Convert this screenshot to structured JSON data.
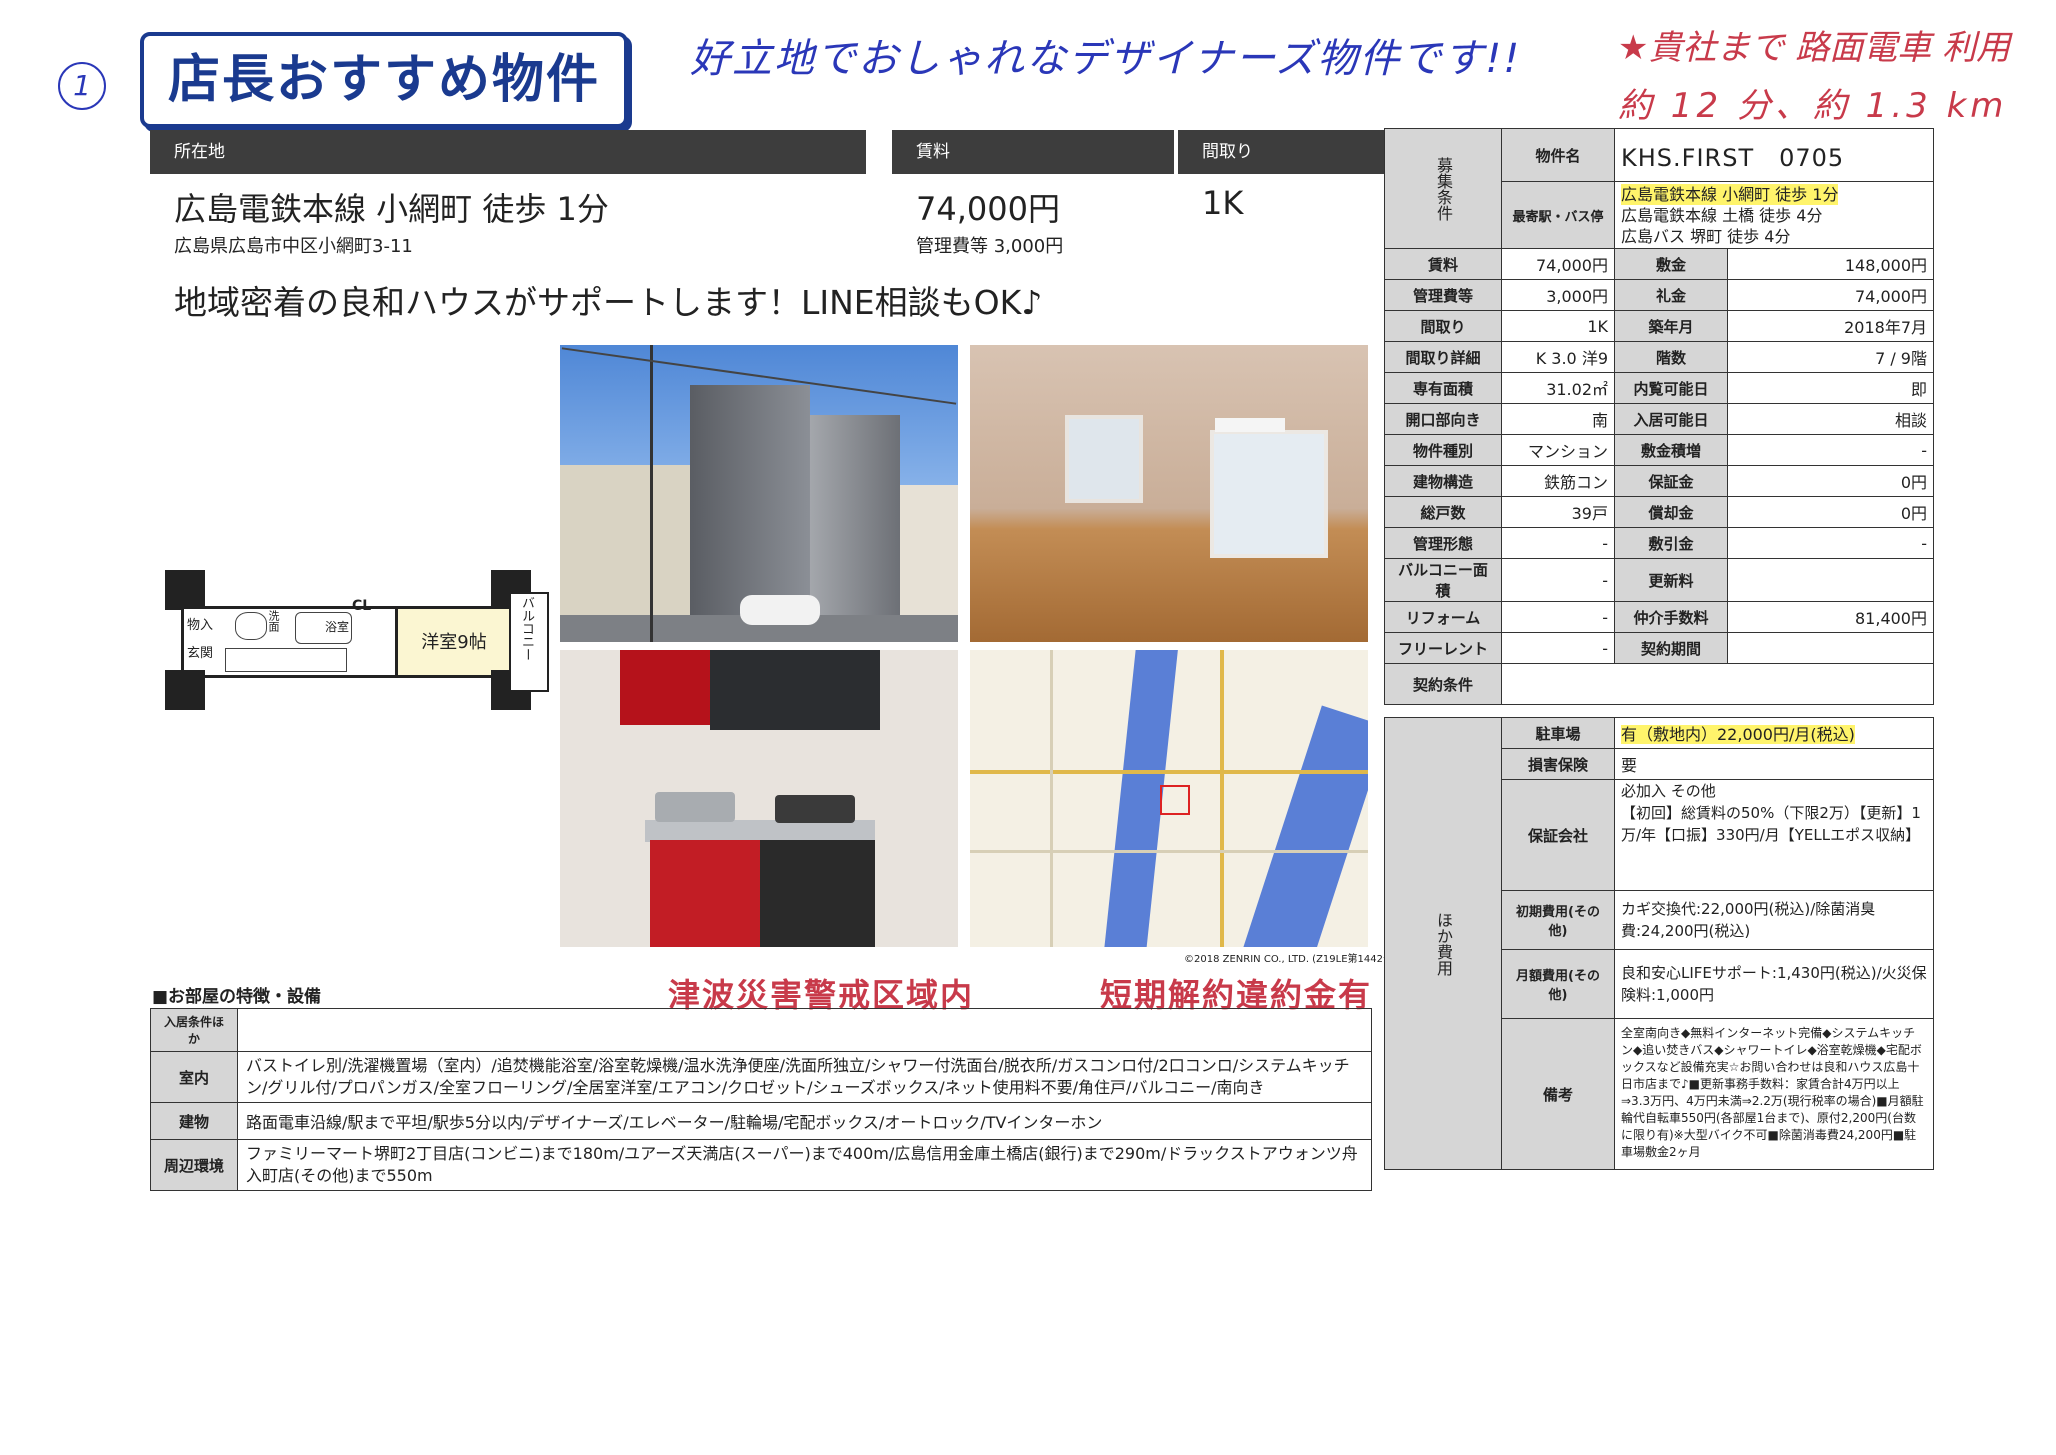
{
  "handwriting": {
    "number": "1",
    "comment": "好立地でおしゃれなデザイナーズ物件です!!",
    "access_line1": "★貴社まで 路面電車 利用",
    "access_line2": "約 12 分、約 1.3 km"
  },
  "badge": "店長おすすめ物件",
  "header": {
    "location_label": "所在地",
    "rent_label": "賃料",
    "layout_label": "間取り",
    "station_access": "広島電鉄本線 小網町 徒歩 1分",
    "address": "広島県広島市中区小網町3-11",
    "rent": "74,000円",
    "mgmt_fee": "管理費等 3,000円",
    "layout": "1K"
  },
  "catchcopy": "地域密着の良和ハウスがサポートします！LINE相談もOK♪",
  "floorplan": {
    "room": "洋室9帖",
    "balcony": "バルコニー",
    "closet": "CL",
    "storage": "物入",
    "entrance": "玄関",
    "washroom": "洗面",
    "bath": "浴室"
  },
  "map_credit": "©2018 ZENRIN CO., LTD. (Z19LE第1442号)",
  "stamps": {
    "tsunami": "津波災害警戒区域内",
    "penalty": "短期解約違約金有"
  },
  "features": {
    "title": "■お部屋の特徴・設備",
    "rows": [
      {
        "label": "入居条件ほか",
        "value": ""
      },
      {
        "label": "室内",
        "value": "バストイレ別/洗濯機置場（室内）/追焚機能浴室/浴室乾燥機/温水洗浄便座/洗面所独立/シャワー付洗面台/脱衣所/ガスコンロ付/2口コンロ/システムキッチン/グリル付/プロパンガス/全室フローリング/全居室洋室/エアコン/クロゼット/シューズボックス/ネット使用料不要/角住戸/バルコニー/南向き"
      },
      {
        "label": "建物",
        "value": "路面電車沿線/駅まで平坦/駅歩5分以内/デザイナーズ/エレベーター/駐輪場/宅配ボックス/オートロック/TVインターホン"
      },
      {
        "label": "周辺環境",
        "value": "ファミリーマート堺町2丁目店(コンビニ)まで180m/ユアーズ天満店(スーパー)まで400m/広島信用金庫土橋店(銀行)まで290m/ドラックストアウォンツ舟入町店(その他)まで550m"
      }
    ]
  },
  "spec": {
    "property_label": "物件名",
    "property_name": "KHS.FIRST　0705",
    "station_label": "最寄駅・バス停",
    "stations": [
      "広島電鉄本線 小網町 徒歩 1分",
      "広島電鉄本線 土橋 徒歩 4分",
      "広島バス 堺町 徒歩 4分"
    ],
    "recruit_side": "募集条件",
    "rows": [
      [
        "賃料",
        "74,000円",
        "敷金",
        "148,000円"
      ],
      [
        "管理費等",
        "3,000円",
        "礼金",
        "74,000円"
      ],
      [
        "間取り",
        "1K",
        "築年月",
        "2018年7月"
      ],
      [
        "間取り詳細",
        "K 3.0 洋9",
        "階数",
        "7 / 9階"
      ],
      [
        "専有面積",
        "31.02㎡",
        "内覧可能日",
        "即"
      ],
      [
        "開口部向き",
        "南",
        "入居可能日",
        "相談"
      ],
      [
        "物件種別",
        "マンション",
        "敷金積増",
        "-"
      ],
      [
        "建物構造",
        "鉄筋コン",
        "保証金",
        "0円"
      ],
      [
        "総戸数",
        "39戸",
        "償却金",
        "0円"
      ],
      [
        "管理形態",
        "-",
        "敷引金",
        "-"
      ],
      [
        "バルコニー面積",
        "-",
        "更新料",
        ""
      ],
      [
        "リフォーム",
        "-",
        "仲介手数料",
        "81,400円"
      ],
      [
        "フリーレント",
        "-",
        "契約期間",
        ""
      ]
    ],
    "contract_label": "契約条件",
    "other_side": "ほか費用",
    "parking_label": "駐車場",
    "parking": "有（敷地内）22,000円/月(税込)",
    "insurance_label": "損害保険",
    "insurance": "要",
    "guarantor_label": "保証会社",
    "guarantor": "必加入 その他\n【初回】総賃料の50%（下限2万）【更新】1万/年【口振】330円/月【YELLエポス収納】",
    "initial_label": "初期費用(その他)",
    "initial": "カギ交換代:22,000円(税込)/除菌消臭費:24,200円(税込)",
    "monthly_label": "月額費用(その他)",
    "monthly": "良和安心LIFEサポート:1,430円(税込)/火災保険料:1,000円",
    "notes_label": "備考",
    "notes": "全室南向き◆無料インターネット完備◆システムキッチン◆追い焚きバス◆シャワートイレ◆浴室乾燥機◆宅配ボックスなど設備充実☆お問い合わせは良和ハウス広島十日市店まで♪■更新事務手数料：家賃合計4万円以上⇒3.3万円、4万円未満⇒2.2万(現行税率の場合)■月額駐輪代自転車550円(各部屋1台まで)、原付2,200円(台数に限り有)※大型バイク不可■除菌消毒費24,200円■駐車場敷金2ヶ月"
  }
}
